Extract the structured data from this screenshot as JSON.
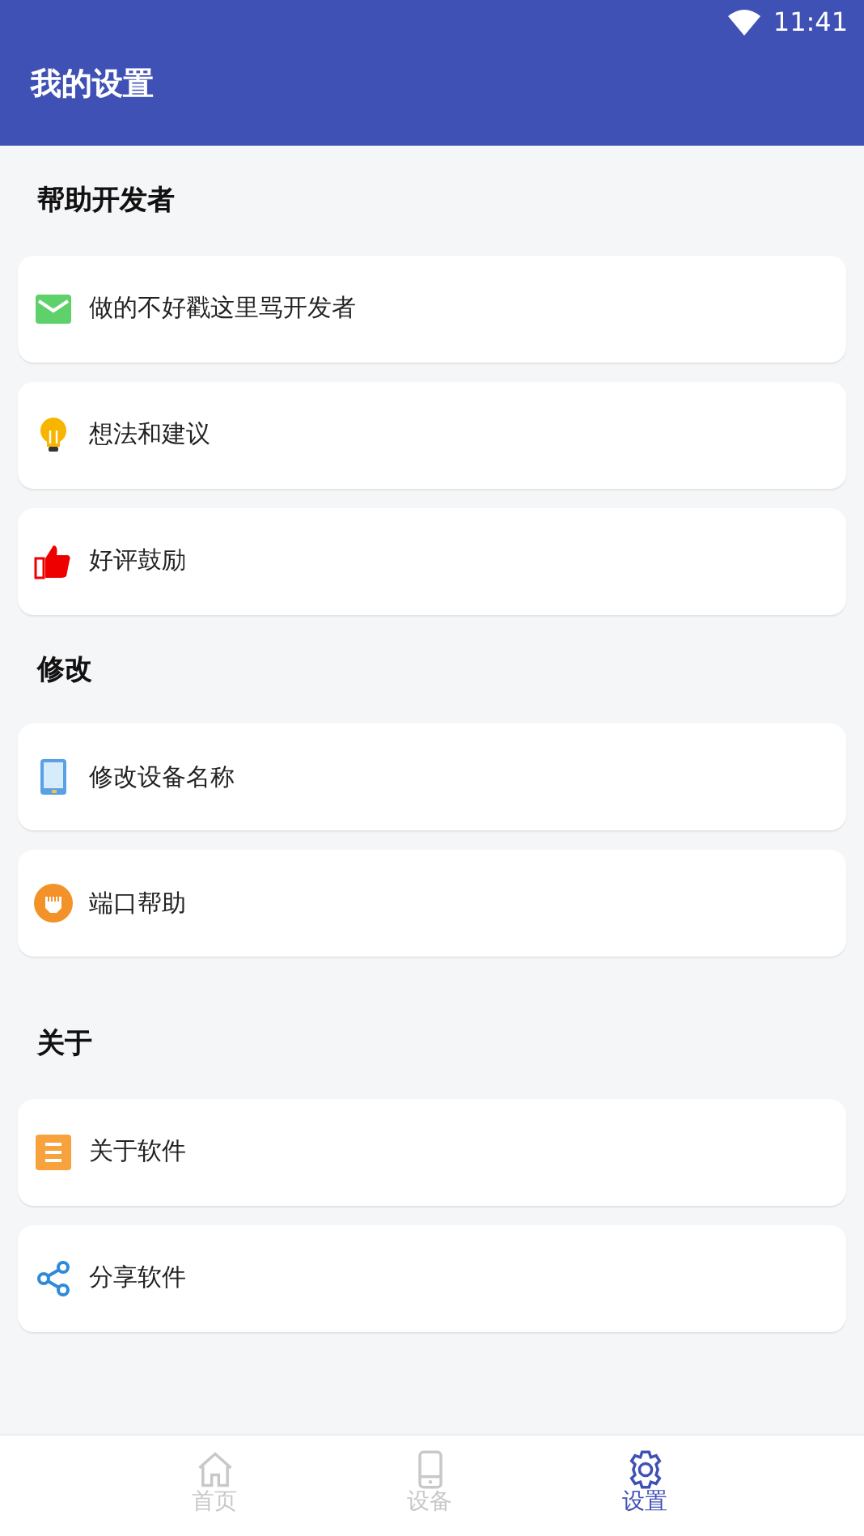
{
  "status_bar": {
    "time": "11:41"
  },
  "app_bar": {
    "title": "我的设置"
  },
  "sections": [
    {
      "title": "帮助开发者",
      "items": [
        {
          "label": "做的不好戳这里骂开发者"
        },
        {
          "label": "想法和建议"
        },
        {
          "label": "好评鼓励"
        }
      ]
    },
    {
      "title": "修改",
      "items": [
        {
          "label": "修改设备名称"
        },
        {
          "label": "端口帮助"
        }
      ]
    },
    {
      "title": "关于",
      "items": [
        {
          "label": "关于软件"
        },
        {
          "label": "分享软件"
        }
      ]
    }
  ],
  "bottom_nav": [
    {
      "label": "首页",
      "selected": false
    },
    {
      "label": "设备",
      "selected": false
    },
    {
      "label": "设置",
      "selected": true
    }
  ]
}
